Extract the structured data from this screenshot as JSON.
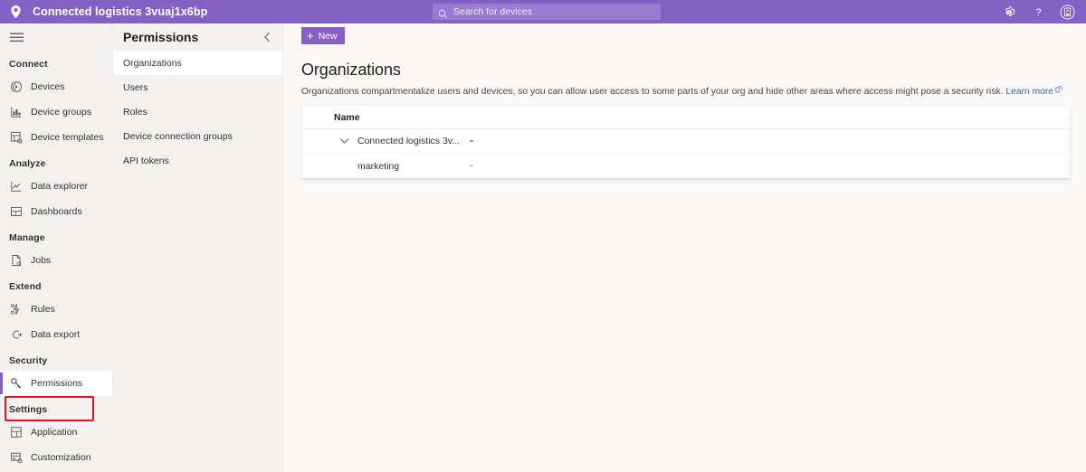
{
  "header": {
    "location_icon": "location-pin-icon",
    "title": "Connected logistics 3vuaj1x6bp",
    "search": {
      "placeholder": "Search for devices",
      "icon": "search-icon"
    },
    "actions": [
      {
        "name": "settings-gear-icon",
        "label": "Settings"
      },
      {
        "name": "help-question-icon",
        "label": "Help"
      },
      {
        "name": "account-avatar-icon",
        "label": "Account"
      }
    ],
    "accent_color": "#8661c5",
    "search_bg": "#9a7bd0"
  },
  "leftnav": {
    "hamburger_label": "Menu",
    "groups": [
      {
        "label": "Connect",
        "items": [
          {
            "label": "Devices",
            "icon": "devices-icon",
            "selected": false
          },
          {
            "label": "Device groups",
            "icon": "device-groups-icon",
            "selected": false
          },
          {
            "label": "Device templates",
            "icon": "device-templates-icon",
            "selected": false
          }
        ]
      },
      {
        "label": "Analyze",
        "items": [
          {
            "label": "Data explorer",
            "icon": "data-explorer-icon",
            "selected": false
          },
          {
            "label": "Dashboards",
            "icon": "dashboards-icon",
            "selected": false
          }
        ]
      },
      {
        "label": "Manage",
        "items": [
          {
            "label": "Jobs",
            "icon": "jobs-icon",
            "selected": false
          }
        ]
      },
      {
        "label": "Extend",
        "items": [
          {
            "label": "Rules",
            "icon": "rules-icon",
            "selected": false
          },
          {
            "label": "Data export",
            "icon": "data-export-icon",
            "selected": false
          }
        ]
      },
      {
        "label": "Security",
        "items": [
          {
            "label": "Permissions",
            "icon": "permissions-key-icon",
            "selected": true
          }
        ]
      },
      {
        "label": "Settings",
        "items": [
          {
            "label": "Application",
            "icon": "application-icon",
            "selected": false
          },
          {
            "label": "Customization",
            "icon": "customization-icon",
            "selected": false
          }
        ]
      }
    ],
    "highlight_color": "#e81123",
    "selected_accent": "#8661c5"
  },
  "panel": {
    "title": "Permissions",
    "collapse_icon": "chevron-left-icon",
    "items": [
      {
        "label": "Organizations",
        "selected": true
      },
      {
        "label": "Users",
        "selected": false
      },
      {
        "label": "Roles",
        "selected": false
      },
      {
        "label": "Device connection groups",
        "selected": false
      },
      {
        "label": "API tokens",
        "selected": false
      }
    ]
  },
  "main": {
    "commandbar": {
      "new_label": "New",
      "new_icon": "plus-icon"
    },
    "page_title": "Organizations",
    "description": "Organizations compartmentalize users and devices, so you can allow user access to some parts of your org and hide other areas where access might pose a security risk.",
    "learn_more": {
      "label": "Learn more",
      "icon": "external-link-icon",
      "color": "#3b63b8"
    },
    "table": {
      "columns": [
        "Name"
      ],
      "rows": [
        {
          "name": "Connected logistics 3v...",
          "level": 0,
          "expanded": true,
          "chevron": "chevron-down-icon",
          "menu": "more-options-icon"
        },
        {
          "name": "marketing",
          "level": 1,
          "expanded": false,
          "chevron": "",
          "menu": "more-options-icon"
        }
      ]
    }
  }
}
